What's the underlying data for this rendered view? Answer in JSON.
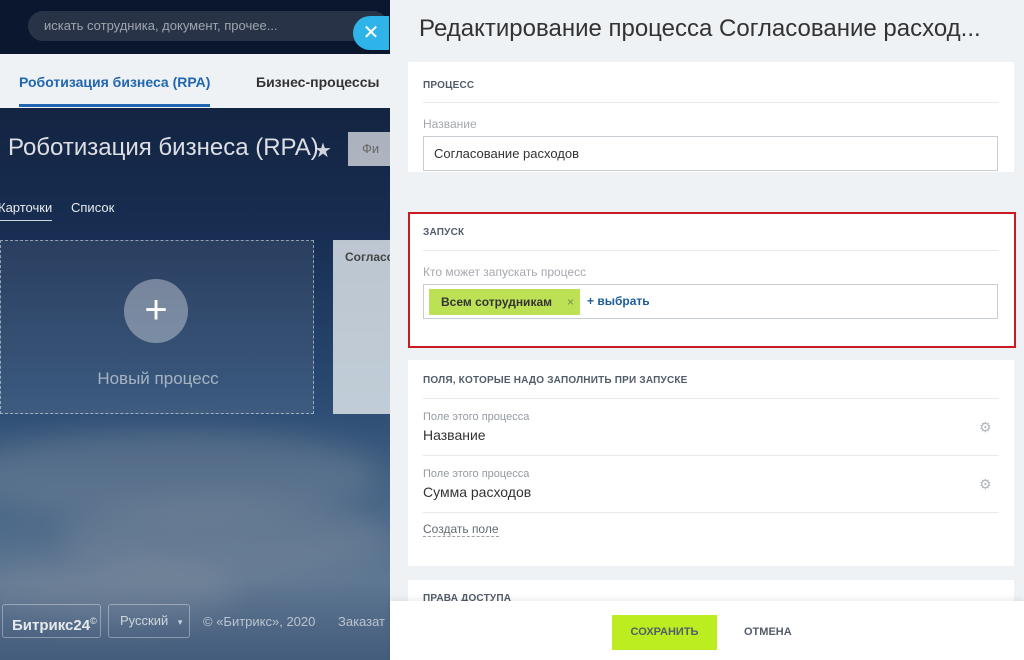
{
  "search": {
    "placeholder": "искать сотрудника, документ, прочее..."
  },
  "close_button": {
    "glyph": "✕"
  },
  "nav_tabs": [
    {
      "label": "Роботизация бизнеса (RPA)",
      "active": true
    },
    {
      "label": "Бизнес-процессы",
      "active": false
    }
  ],
  "page": {
    "title": "Роботизация бизнеса (RPA)",
    "filter_label": "Фи",
    "view_tabs": [
      {
        "label": "Карточки",
        "active": true
      },
      {
        "label": "Список",
        "active": false
      }
    ],
    "new_process_label": "Новый процесс",
    "process_card_title": "Согласо"
  },
  "footer": {
    "brand": "Битрикс24",
    "brand_mark": "©",
    "language": "Русский",
    "copyright": "© «Битрикс», 2020",
    "order_link": "Заказат"
  },
  "slider": {
    "title": "Редактирование процесса Согласование расход...",
    "process_section": {
      "heading": "ПРОЦЕСС",
      "name_label": "Название",
      "name_value": "Согласование расходов"
    },
    "launch_section": {
      "heading": "ЗАПУСК",
      "who_label": "Кто может запускать процесс",
      "tag": "Всем сотрудникам",
      "tag_remove": "×",
      "add_link": "+ выбрать"
    },
    "fields_section": {
      "heading": "ПОЛЯ, КОТОРЫЕ НАДО ЗАПОЛНИТЬ ПРИ ЗАПУСКЕ",
      "fields": [
        {
          "label": "Поле этого процесса",
          "value": "Название"
        },
        {
          "label": "Поле этого процесса",
          "value": "Сумма расходов"
        }
      ],
      "create_field": "Создать поле"
    },
    "access_section": {
      "heading": "ПРАВА ДОСТУПА"
    },
    "buttons": {
      "save": "СОХРАНИТЬ",
      "cancel": "ОТМЕНА"
    }
  },
  "colors": {
    "accent_blue": "#2066b0",
    "close_button": "#2fb4e9",
    "save_button": "#bbed21",
    "tag_green": "#bde155",
    "highlight_red": "#c81a20"
  }
}
